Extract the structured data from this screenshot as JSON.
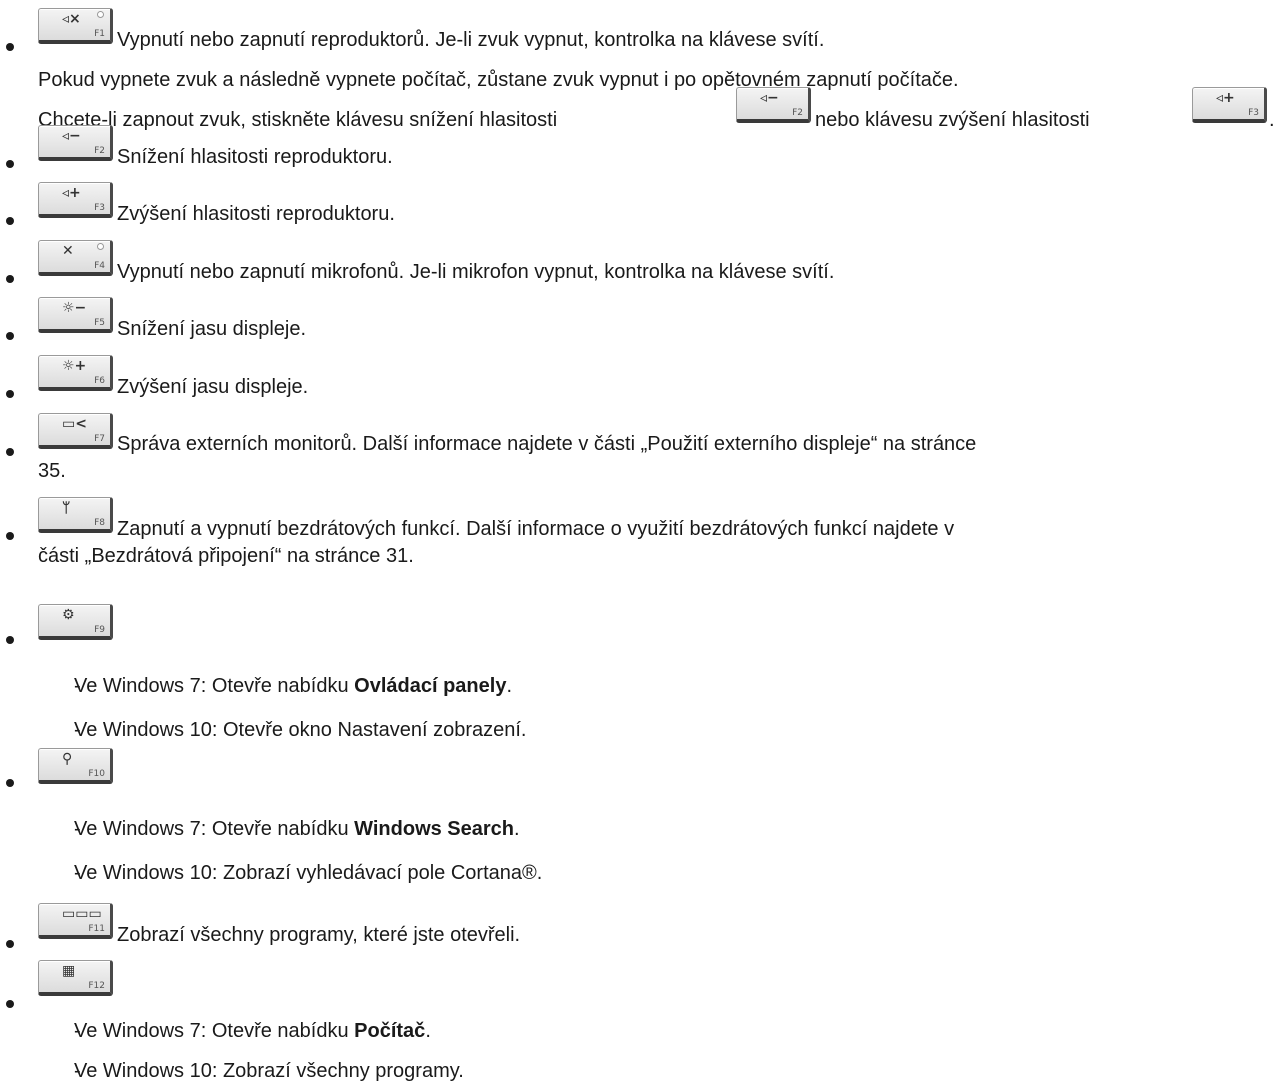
{
  "items": [
    {
      "key": {
        "label": "F1",
        "icon": "speaker-mute-icon",
        "glyph": "◃×"
      },
      "lines": [
        "Vypnutí nebo zapnutí reproduktorů. Je-li zvuk vypnut, kontrolka na klávese svítí.",
        "Pokud vypnete zvuk a následně vypnete počítač, zůstane zvuk vypnut i po opětovném zapnutí počítače.",
        "Chcete-li zapnout zvuk, stiskněte klávesu snížení hlasitosti",
        "nebo klávesu zvýšení hlasitosti",
        "."
      ]
    },
    {
      "key": {
        "label": "F2",
        "icon": "volume-down-icon",
        "glyph": "◃−"
      },
      "text": "Snížení hlasitosti reproduktoru."
    },
    {
      "key": {
        "label": "F3",
        "icon": "volume-up-icon",
        "glyph": "◃+"
      },
      "text": "Zvýšení hlasitosti reproduktoru."
    },
    {
      "key": {
        "label": "F4",
        "icon": "microphone-mute-icon",
        "glyph": "✕"
      },
      "text": "Vypnutí nebo zapnutí mikrofonů. Je-li mikrofon vypnut, kontrolka na klávese svítí."
    },
    {
      "key": {
        "label": "F5",
        "icon": "brightness-down-icon",
        "glyph": "☼−"
      },
      "text": "Snížení jasu displeje."
    },
    {
      "key": {
        "label": "F6",
        "icon": "brightness-up-icon",
        "glyph": "☼+"
      },
      "text": "Zvýšení jasu displeje."
    },
    {
      "key": {
        "label": "F7",
        "icon": "external-monitor-icon",
        "glyph": "▭<"
      },
      "line1": "Správa externích monitorů. Další informace najdete v části „Použití externího displeje“ na stránce",
      "line2": "35."
    },
    {
      "key": {
        "label": "F8",
        "icon": "wireless-icon",
        "glyph": "ᛘ"
      },
      "line1": "Zapnutí a vypnutí bezdrátových funkcí. Další informace o využití bezdrátových funkcí najdete v",
      "line2": "části „Bezdrátová připojení“ na stránce 31."
    },
    {
      "key": {
        "label": "F9",
        "icon": "settings-icon",
        "glyph": "⚙"
      },
      "sub": [
        {
          "prefix": "Ve Windows 7: Otevře nabídku ",
          "bold": "Ovládací panely",
          "suffix": "."
        },
        {
          "prefix": "Ve Windows 10: Otevře okno Nastavení zobrazení.",
          "bold": "",
          "suffix": ""
        }
      ]
    },
    {
      "key": {
        "label": "F10",
        "icon": "search-icon",
        "glyph": "⚲"
      },
      "sub": [
        {
          "prefix": "Ve Windows 7: Otevře nabídku ",
          "bold": "Windows Search",
          "suffix": "."
        },
        {
          "prefix": "Ve Windows 10: Zobrazí vyhledávací pole Cortana",
          "bold": "",
          "suffix": "®."
        }
      ]
    },
    {
      "key": {
        "label": "F11",
        "icon": "task-view-icon",
        "glyph": "▭▭▭"
      },
      "text": "Zobrazí všechny programy, které jste otevřeli."
    },
    {
      "key": {
        "label": "F12",
        "icon": "apps-grid-icon",
        "glyph": "▦"
      },
      "sub": [
        {
          "prefix": "Ve Windows 7: Otevře nabídku ",
          "bold": "Počítač",
          "suffix": "."
        },
        {
          "prefix": "Ve Windows 10: Zobrazí všechny programy.",
          "bold": "",
          "suffix": ""
        }
      ]
    }
  ]
}
